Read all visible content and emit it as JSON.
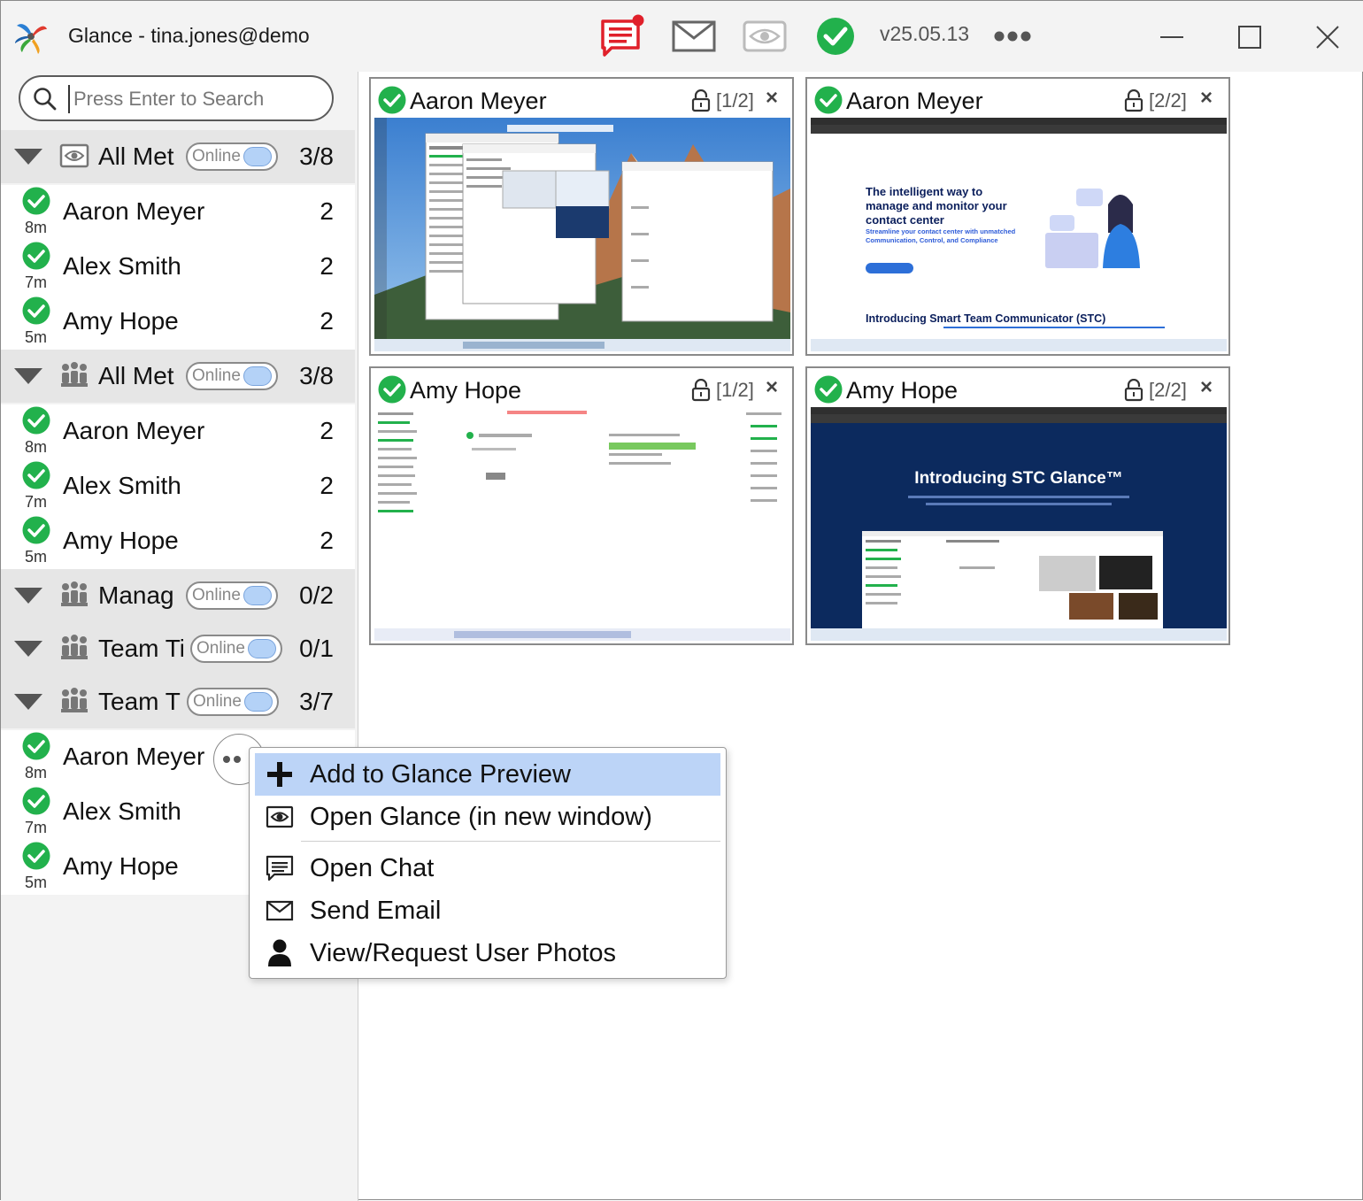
{
  "window": {
    "title": "Glance - tina.jones@demo",
    "version": "v25.05.13"
  },
  "search": {
    "placeholder": "Press Enter to Search"
  },
  "groups": [
    {
      "name": "All Met",
      "toggle": "Online",
      "count": "3/8",
      "icon": "eye-icon"
    },
    {
      "name": "All Met",
      "toggle": "Online",
      "count": "3/8",
      "icon": "team-icon"
    },
    {
      "name": "Manag",
      "toggle": "Online",
      "count": "0/2",
      "icon": "team-icon"
    },
    {
      "name": "Team Ti",
      "toggle": "Online",
      "count": "0/1",
      "icon": "team-icon"
    },
    {
      "name": "Team T",
      "toggle": "Online",
      "count": "3/7",
      "icon": "team-icon"
    }
  ],
  "users": [
    {
      "name": "Aaron Meyer",
      "ago": "8m",
      "count": "2"
    },
    {
      "name": "Alex Smith",
      "ago": "7m",
      "count": "2"
    },
    {
      "name": "Amy Hope",
      "ago": "5m",
      "count": "2"
    },
    {
      "name": "Aaron Meyer",
      "ago": "8m",
      "count": "2"
    },
    {
      "name": "Alex Smith",
      "ago": "7m",
      "count": "2"
    },
    {
      "name": "Amy Hope",
      "ago": "5m",
      "count": "2"
    },
    {
      "name": "Aaron Meyer",
      "ago": "8m",
      "count": ""
    },
    {
      "name": "Alex Smith",
      "ago": "7m",
      "count": ""
    },
    {
      "name": "Amy Hope",
      "ago": "5m",
      "count": ""
    }
  ],
  "previews": [
    {
      "name": "Aaron Meyer",
      "page": "[1/2]",
      "close": "×"
    },
    {
      "name": "Aaron Meyer",
      "page": "[2/2]",
      "close": "×",
      "headline": "The intelligent way to manage and monitor your contact center",
      "sub": "Streamline your contact center with unmatched Communication, Control, and Compliance",
      "footer": "Introducing Smart Team Communicator (STC)"
    },
    {
      "name": "Amy Hope",
      "page": "[1/2]",
      "close": "×"
    },
    {
      "name": "Amy Hope",
      "page": "[2/2]",
      "close": "×",
      "headline": "Introducing STC Glance™"
    }
  ],
  "context_menu": [
    {
      "label": "Add to Glance Preview",
      "icon": "plus-icon",
      "highlighted": true
    },
    {
      "label": "Open Glance (in new window)",
      "icon": "eye-icon"
    },
    {
      "label": "Open Chat",
      "icon": "chat-icon"
    },
    {
      "label": "Send Email",
      "icon": "envelope-icon"
    },
    {
      "label": "View/Request User Photos",
      "icon": "person-icon"
    }
  ],
  "colors": {
    "online_green": "#22b14c",
    "highlight": "#bcd4f7",
    "chat_red": "#e0202a",
    "toggle_blue": "#b4d2f7"
  }
}
